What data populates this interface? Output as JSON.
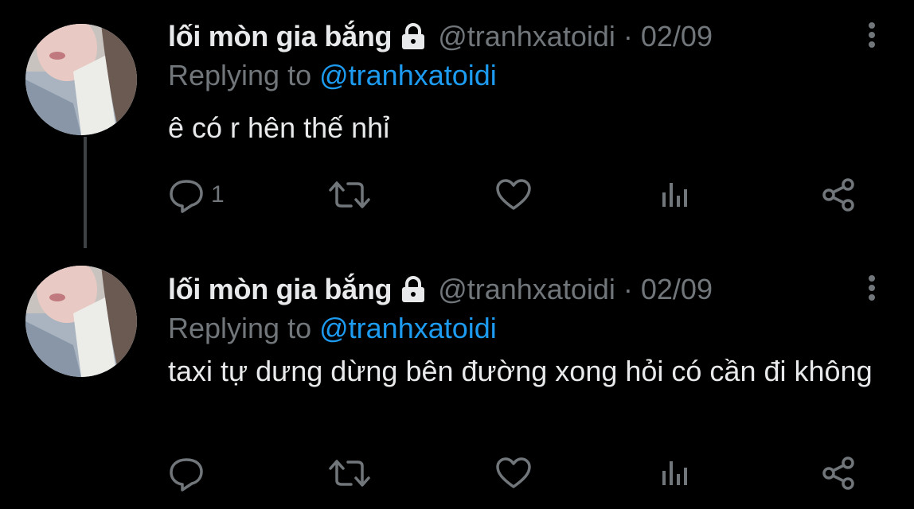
{
  "colors": {
    "background": "#000000",
    "text_primary": "#e7e9ea",
    "text_secondary": "#71767b",
    "link": "#1d9bf0",
    "thread_line": "#3e4144"
  },
  "tweets": [
    {
      "display_name": "lối mòn gia bắng",
      "protected_icon": "lock-icon",
      "handle": "@tranhxatoidi",
      "separator": "·",
      "date": "02/09",
      "replying_prefix": "Replying to",
      "replying_handle": "@tranhxatoidi",
      "text": "ê có r hên thế nhỉ",
      "reply_count": "1",
      "icons": [
        "reply-icon",
        "retweet-icon",
        "like-icon",
        "views-icon",
        "share-icon",
        "more-icon"
      ]
    },
    {
      "display_name": "lối mòn gia bắng",
      "protected_icon": "lock-icon",
      "handle": "@tranhxatoidi",
      "separator": "·",
      "date": "02/09",
      "replying_prefix": "Replying to",
      "replying_handle": "@tranhxatoidi",
      "text": "taxi tự dưng dừng bên đường xong hỏi có cần đi không",
      "reply_count": "",
      "icons": [
        "reply-icon",
        "retweet-icon",
        "like-icon",
        "views-icon",
        "share-icon",
        "more-icon"
      ]
    }
  ]
}
